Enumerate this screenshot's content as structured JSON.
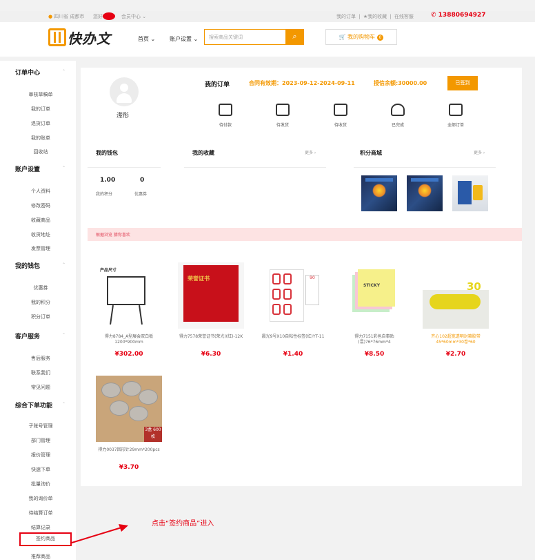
{
  "topbar": {
    "location": "四川省 成都市",
    "hello": "您好",
    "member_center": "会员中心 ⌄",
    "my_orders": "我的订单",
    "my_favorites": "★我的收藏",
    "online_consult": "在线客服",
    "separator": "|",
    "phone": "✆ 13880694927"
  },
  "header": {
    "logo_text": "快办文",
    "nav_home": "首页 ⌄",
    "nav_account": "账户设置 ⌄",
    "search_placeholder": "搜索商品关键词",
    "search_icon": "⌕",
    "cart_label": "🛒 我的购物车",
    "cart_count": "0"
  },
  "sidebar": {
    "caret": "⌃",
    "sections": [
      {
        "title": "订单中心",
        "items": [
          "审核草稿单",
          "我的订单",
          "退货订单",
          "我的账单",
          "回收站"
        ]
      },
      {
        "title": "账户设置",
        "items": [
          "个人资料",
          "修改密码",
          "收藏商品",
          "收货地址",
          "发票管理"
        ]
      },
      {
        "title": "我的钱包",
        "items": [
          "优惠券",
          "我的积分",
          "积分订单"
        ]
      },
      {
        "title": "客户服务",
        "items": [
          "售后服务",
          "联系我们",
          "常见问题"
        ]
      },
      {
        "title": "综合下单功能",
        "items": [
          "子账号管理",
          "部门管理",
          "报价管理",
          "快速下单",
          "批量询价",
          "我的询价单",
          "待结算订单",
          "结算记录",
          "签约商品",
          "推荐商品"
        ]
      }
    ]
  },
  "profile": {
    "username": "潆彤"
  },
  "orders": {
    "title": "我的订单",
    "contract": "合同有效期：2023-09-12-2024-09-11",
    "credit": "授信余额:30000.00",
    "view_button": "已签到",
    "statuses": [
      {
        "label": "待付款",
        "icon": "wallet-icon"
      },
      {
        "label": "待发货",
        "icon": "box-icon"
      },
      {
        "label": "待收货",
        "icon": "truck-icon"
      },
      {
        "label": "已完成",
        "icon": "flower-icon"
      },
      {
        "label": "全部订单",
        "icon": "clipboard-icon"
      }
    ]
  },
  "wallet": {
    "title": "我的钱包",
    "points_value": "1.00",
    "points_label": "我的积分",
    "coupons_value": "0",
    "coupons_label": "优惠券"
  },
  "favorites": {
    "title": "我的收藏",
    "more": "更多 ›"
  },
  "points_mall": {
    "title": "积分商城",
    "more": "更多 ›"
  },
  "recommend_banner": "根据浏览 猜你喜欢",
  "products": [
    {
      "name": "得力8784_A型展会双白板1200*900mm",
      "price": "¥302.00",
      "img_label": "产品尺寸"
    },
    {
      "name": "得力7578荣誉证书(荣光)(红)-12K",
      "price": "¥6.30",
      "img_label": "荣誉证书"
    },
    {
      "name": "晨光9号X10自粘性标签(红)YT-11",
      "price": "¥1.40",
      "img_label": "90"
    },
    {
      "name": "得力7151彩色自事贴(混)76*76mm*4",
      "price": "¥8.50",
      "img_label": "STICKY"
    },
    {
      "name": "齐心102超宽透明封箱胶带45*60mm*30卷*60",
      "price": "¥2.70",
      "img_label": "30"
    },
    {
      "name": "得力0037回形针29mm*200pcs",
      "price": "¥3.70",
      "img_label": "3盒 600枚"
    }
  ],
  "annotation": {
    "highlighted_item": "签约商品",
    "instruction": "点击“签约商品”进入"
  },
  "colors": {
    "accent": "#f39800",
    "price_red": "#e60012",
    "banner_bg": "#fde3e3"
  }
}
